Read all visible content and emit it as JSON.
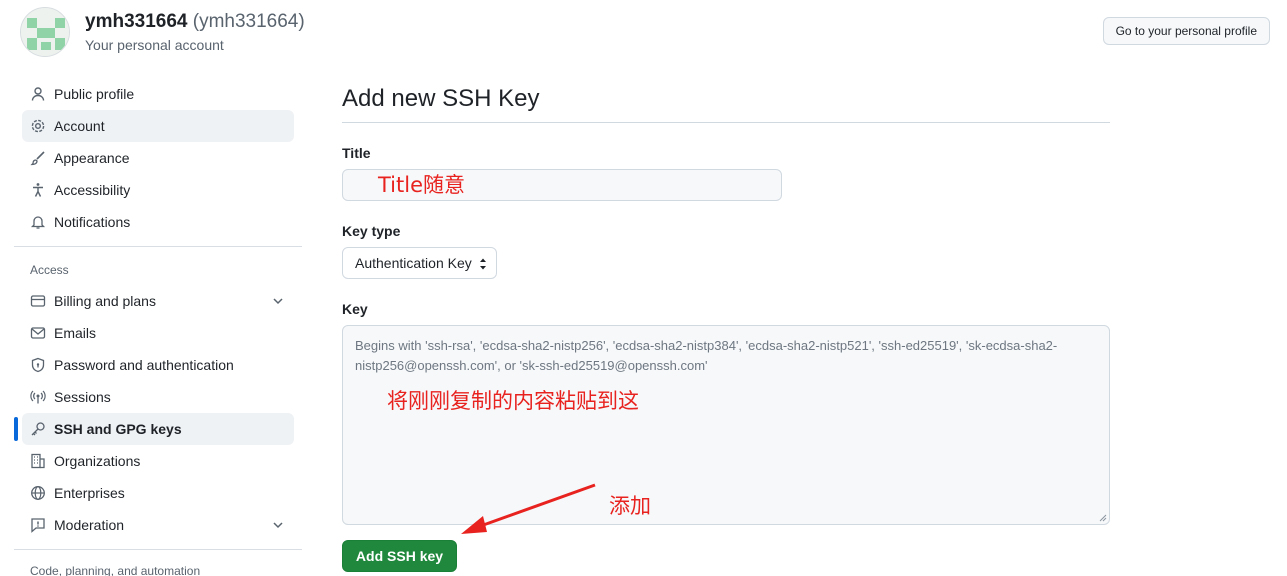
{
  "header": {
    "display_name": "ymh331664",
    "login": "(ymh331664)",
    "subtitle": "Your personal account",
    "profile_button": "Go to your personal profile"
  },
  "sidebar": {
    "items_top": [
      {
        "label": "Public profile",
        "icon": "person-icon"
      },
      {
        "label": "Account",
        "icon": "gear-icon"
      },
      {
        "label": "Appearance",
        "icon": "paintbrush-icon"
      },
      {
        "label": "Accessibility",
        "icon": "accessibility-icon"
      },
      {
        "label": "Notifications",
        "icon": "bell-icon"
      }
    ],
    "access_title": "Access",
    "items_access": [
      {
        "label": "Billing and plans",
        "icon": "credit-card-icon"
      },
      {
        "label": "Emails",
        "icon": "mail-icon"
      },
      {
        "label": "Password and authentication",
        "icon": "shield-lock-icon"
      },
      {
        "label": "Sessions",
        "icon": "broadcast-icon"
      },
      {
        "label": "SSH and GPG keys",
        "icon": "key-icon"
      },
      {
        "label": "Organizations",
        "icon": "organization-icon"
      },
      {
        "label": "Enterprises",
        "icon": "globe-icon"
      },
      {
        "label": "Moderation",
        "icon": "report-icon"
      }
    ],
    "next_group_title": "Code, planning, and automation"
  },
  "main": {
    "page_title": "Add new SSH Key",
    "title_label": "Title",
    "title_annotation": "Title随意",
    "key_type_label": "Key type",
    "key_type_value": "Authentication Key",
    "key_label": "Key",
    "key_placeholder": "Begins with 'ssh-rsa', 'ecdsa-sha2-nistp256', 'ecdsa-sha2-nistp384', 'ecdsa-sha2-nistp521', 'ssh-ed25519', 'sk-ecdsa-sha2-nistp256@openssh.com', or 'sk-ssh-ed25519@openssh.com'",
    "key_annotation": "将刚刚复制的内容粘贴到这",
    "add_button": "Add SSH key",
    "add_annotation": "添加"
  },
  "colors": {
    "accent": "#0969da",
    "primary_button": "#1f883d",
    "annotation": "#e8231f"
  }
}
